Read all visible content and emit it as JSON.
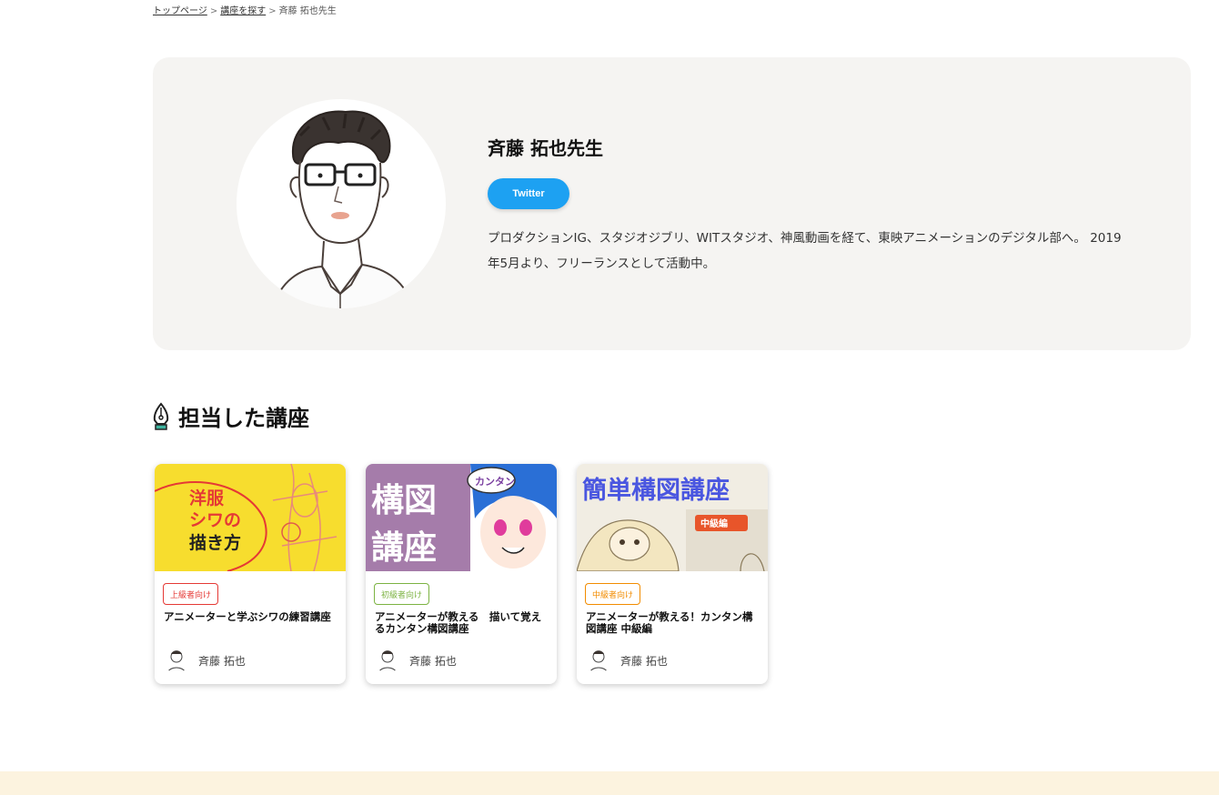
{
  "breadcrumb": {
    "items": [
      {
        "label": "トップページ"
      },
      {
        "label": "講座を探す"
      },
      {
        "label": "斉藤 拓也先生"
      }
    ],
    "separator": ">"
  },
  "profile": {
    "name": "斉藤 拓也先生",
    "twitter_label": "Twitter",
    "twitter_color": "#1da1f2",
    "bio": "プロダクションIG、スタジオジブリ、WITスタジオ、神風動画を経て、東映アニメーションのデジタル部へ。 2019年5月より、フリーランスとして活動中。"
  },
  "section": {
    "title": "担当した講座",
    "icon": "pen-nib-icon"
  },
  "courses": [
    {
      "thumb_text": [
        "洋服",
        "シワの",
        "描き方"
      ],
      "level": "上級者向け",
      "level_color": "#e53935",
      "title": "アニメーターと学ぶシワの練習講座",
      "author": "斉藤 拓也"
    },
    {
      "thumb_text": [
        "構図",
        "講座",
        "カンタン"
      ],
      "level": "初級者向け",
      "level_color": "#7cb342",
      "title": "アニメーターが教える　描いて覚えるカンタン構図講座",
      "author": "斉藤 拓也"
    },
    {
      "thumb_text": [
        "簡単構図講座",
        "中級編"
      ],
      "level": "中級者向け",
      "level_color": "#f28c00",
      "title": "アニメーターが教える！カンタン構図講座 中級編",
      "author": "斉藤 拓也"
    }
  ]
}
